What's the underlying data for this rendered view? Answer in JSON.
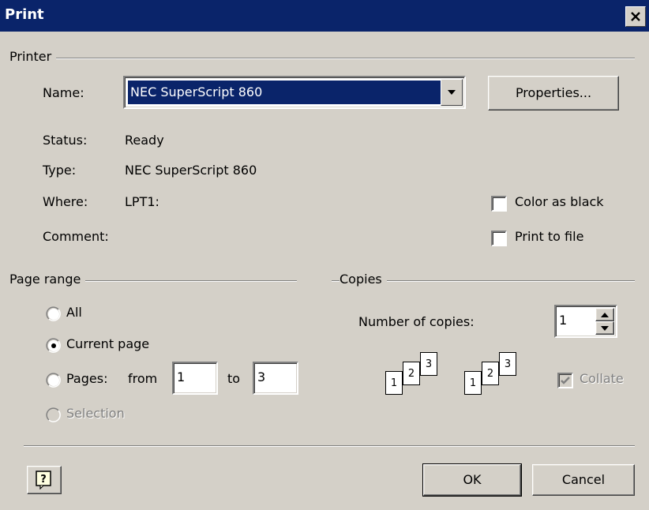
{
  "title": "Print",
  "printer": {
    "group_label": "Printer",
    "name_label": "Name:",
    "name_value": "NEC SuperScript 860",
    "properties_label": "Properties...",
    "status_label": "Status:",
    "status_value": "Ready",
    "type_label": "Type:",
    "type_value": "NEC SuperScript 860",
    "where_label": "Where:",
    "where_value": "LPT1:",
    "comment_label": "Comment:",
    "color_as_black_label": "Color as black",
    "color_as_black_checked": false,
    "print_to_file_label": "Print to file",
    "print_to_file_checked": false
  },
  "page_range": {
    "group_label": "Page range",
    "all_label": "All",
    "current_page_label": "Current page",
    "pages_label": "Pages:",
    "from_label": "from",
    "from_value": "1",
    "to_label": "to",
    "to_value": "3",
    "selection_label": "Selection",
    "selected": "current_page"
  },
  "copies": {
    "group_label": "Copies",
    "number_label": "Number of copies:",
    "number_value": "1",
    "collate_label": "Collate",
    "collate_checked": true,
    "collate_enabled": false,
    "page_labels": [
      "1",
      "2",
      "3"
    ]
  },
  "buttons": {
    "ok_label": "OK",
    "cancel_label": "Cancel"
  },
  "colors": {
    "title_bar": "#0a246a",
    "face": "#d4d0c8",
    "selection": "#0a246a"
  }
}
